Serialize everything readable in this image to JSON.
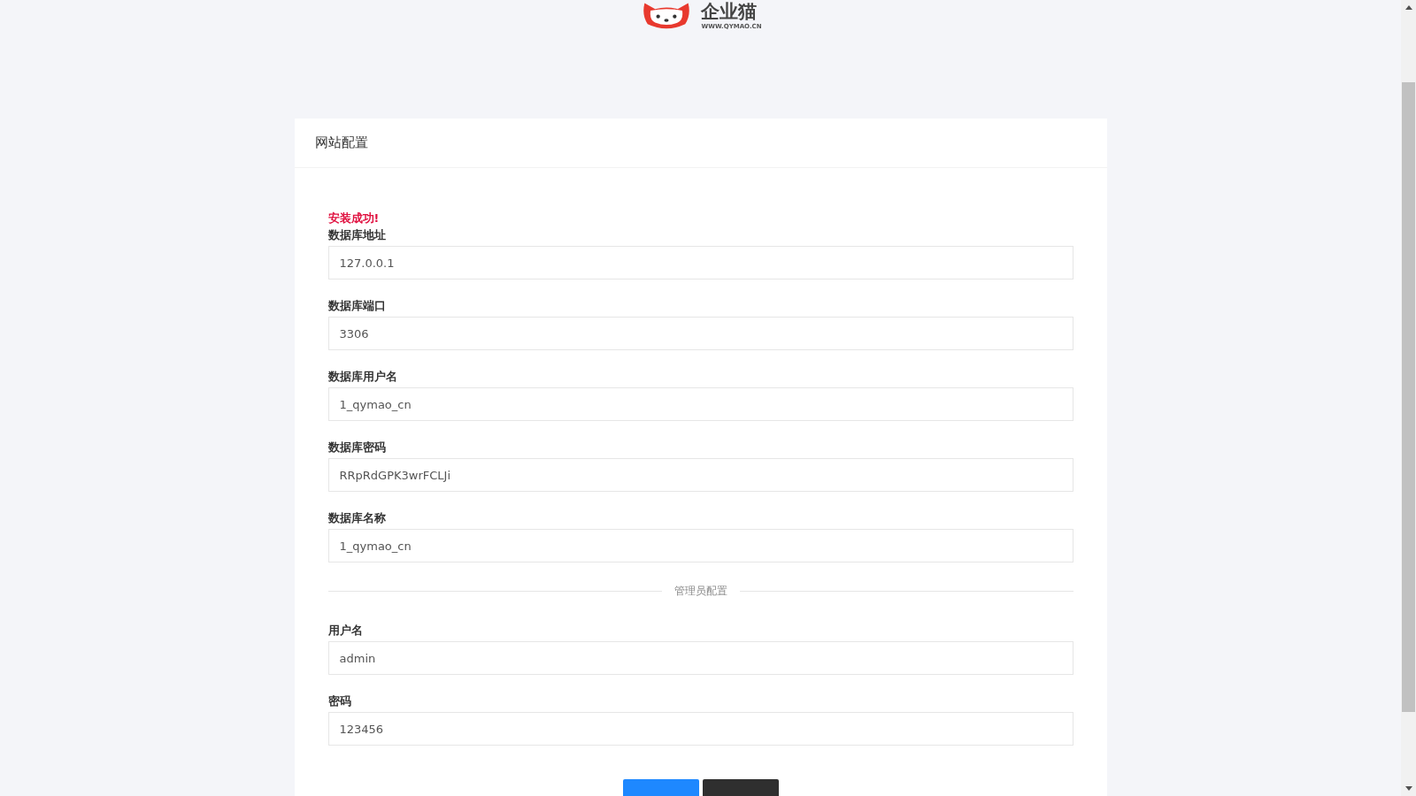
{
  "logo": {
    "name": "企业猫",
    "url": "WWW.QYMAO.CN"
  },
  "card": {
    "title": "网站配置"
  },
  "message": "安装成功!",
  "database_fields": [
    {
      "label": "数据库地址",
      "value": "127.0.0.1"
    },
    {
      "label": "数据库端口",
      "value": "3306"
    },
    {
      "label": "数据库用户名",
      "value": "1_qymao_cn"
    },
    {
      "label": "数据库密码",
      "value": "RRpRdGPK3wrFCLJi"
    },
    {
      "label": "数据库名称",
      "value": "1_qymao_cn"
    }
  ],
  "divider": "管理员配置",
  "admin_fields": [
    {
      "label": "用户名",
      "value": "admin"
    },
    {
      "label": "密码",
      "value": "123456"
    }
  ],
  "buttons": [
    {
      "kind": "primary"
    },
    {
      "kind": "dark"
    }
  ]
}
